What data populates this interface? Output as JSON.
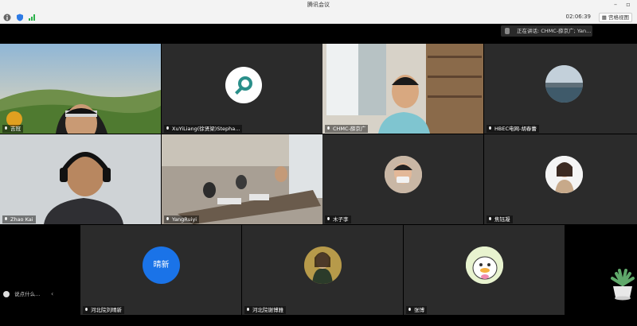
{
  "window": {
    "title": "腾讯会议"
  },
  "toolbar": {
    "timer": "02:06:39",
    "view_label": "宫格视图"
  },
  "speaking": {
    "text": "正在讲话: CHMC-薛京广; Yan..."
  },
  "participants": [
    {
      "name": "吉冠"
    },
    {
      "name": "XuYiLiang(徐贤梁)Stepha..."
    },
    {
      "name": "CHMC-薛京广"
    },
    {
      "name": "HBEC电网-胡春蕾"
    },
    {
      "name": "Zhao Kai"
    },
    {
      "name": "YangRuiyi"
    },
    {
      "name": "木子李"
    },
    {
      "name": "焦钰凝"
    },
    {
      "name": "河北院刘晴新",
      "avatar_text": "晴新"
    },
    {
      "name": "河北院谢博雅"
    },
    {
      "name": "张博"
    }
  ],
  "chat": {
    "placeholder": "说点什么..."
  },
  "colors": {
    "tile_bg": "#2b2b2b",
    "avatar_blue": "#1a73e8",
    "accent_teal": "#2a8f8a"
  }
}
